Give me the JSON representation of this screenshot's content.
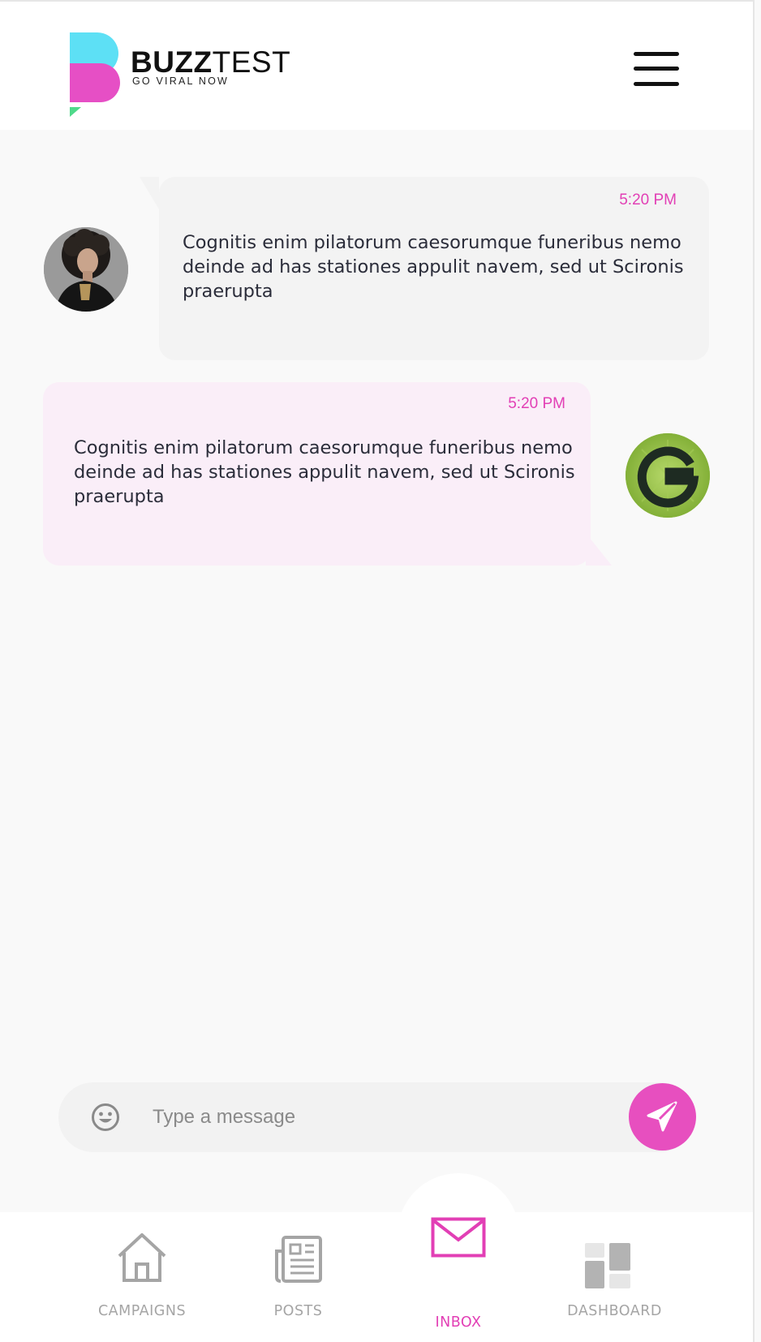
{
  "brand": {
    "name_bold": "BUZZ",
    "name_light": "TEST",
    "tagline": "GO VIRAL NOW",
    "colors": {
      "cyan": "#5de0f5",
      "pink": "#e64fc5",
      "green": "#4fd98a"
    }
  },
  "header": {
    "menu_icon": "hamburger-menu-icon"
  },
  "messages": [
    {
      "direction": "incoming",
      "time": "5:20 PM",
      "text": "Cognitis enim pilatorum caesorumque funeribus nemo deinde ad has stationes appulit navem, sed ut Scironis praerupta",
      "avatar": "woman-avatar"
    },
    {
      "direction": "outgoing",
      "time": "5:20 PM",
      "text": "Cognitis enim pilatorum caesorumque funeribus nemo deinde ad has stationes appulit navem, sed ut Scironis praerupta",
      "avatar": "g-brand-avatar"
    }
  ],
  "composer": {
    "placeholder": "Type a message",
    "value": "",
    "emoji_icon": "smiley-icon",
    "send_icon": "send-arrow-icon"
  },
  "nav": {
    "items": [
      {
        "label": "CAMPAIGNS",
        "icon": "home-icon",
        "active": false
      },
      {
        "label": "POSTS",
        "icon": "newspaper-icon",
        "active": false
      },
      {
        "label": "INBOX",
        "icon": "envelope-icon",
        "active": true
      },
      {
        "label": "DASHBOARD",
        "icon": "dashboard-icon",
        "active": false
      }
    ]
  },
  "theme": {
    "accent": "#e23fb5",
    "inactive": "#a5a5a5",
    "bubble_in": "#f3f3f3",
    "bubble_out": "#faeef8"
  }
}
